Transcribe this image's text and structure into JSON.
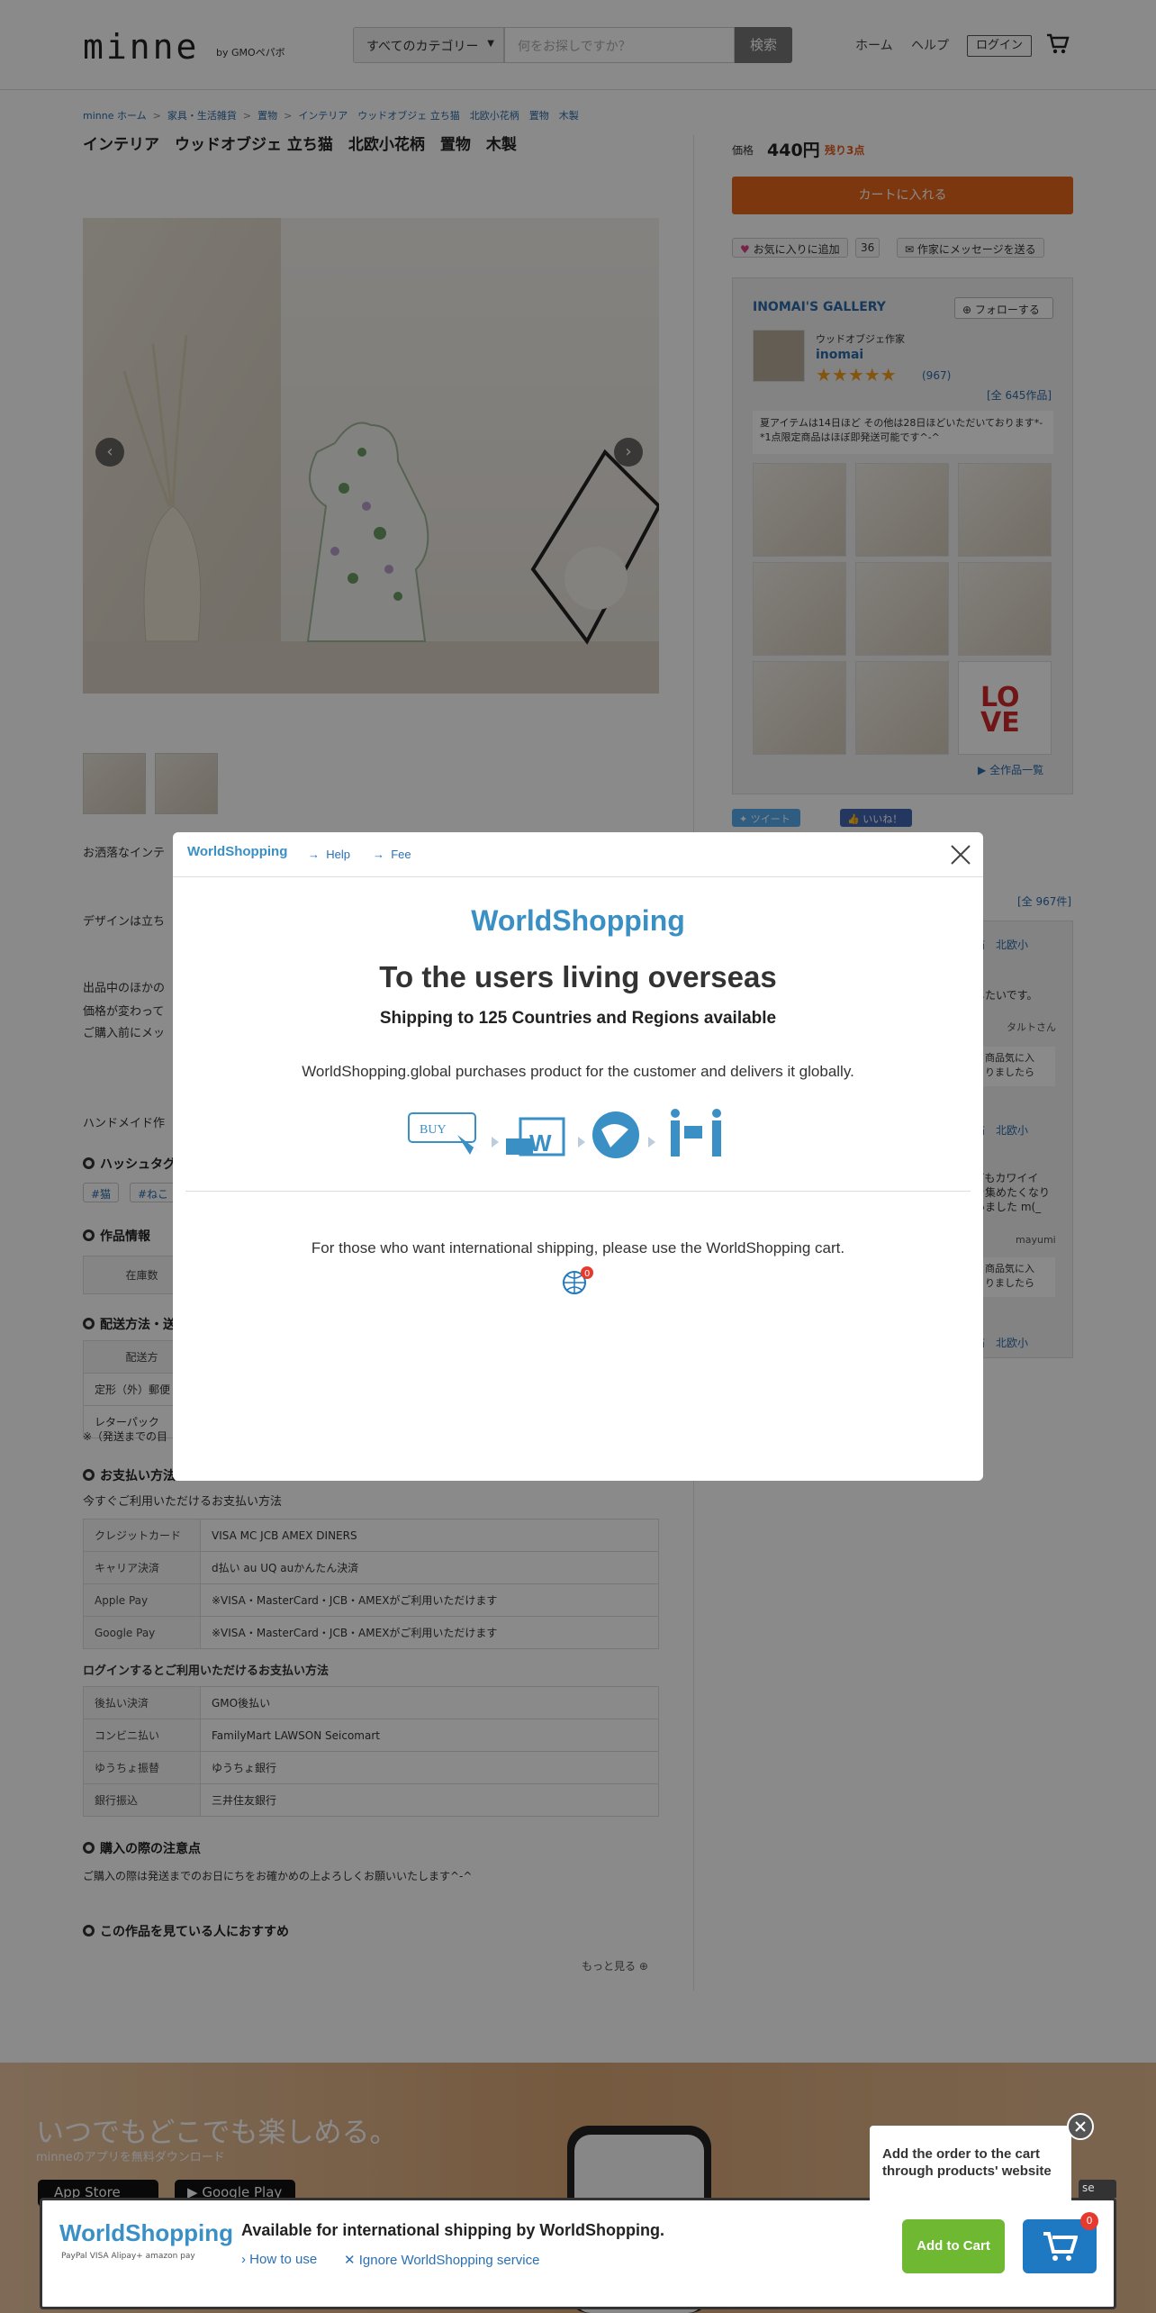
{
  "header": {
    "logo": "minne",
    "logo_sub": "by GMOペパボ",
    "category_select": "すべてのカテゴリー",
    "search_placeholder": "何をお探しですか？",
    "search_button": "検索",
    "nav": [
      "ホーム",
      "ヘルプ"
    ],
    "login": "ログイン"
  },
  "breadcrumb": [
    "minne ホーム",
    "家具・生活雑貨",
    "置物",
    "インテリア　ウッドオブジェ 立ち猫　北欧小花柄　置物　木製"
  ],
  "product": {
    "title": "インテリア　ウッドオブジェ 立ち猫　北欧小花柄　置物　木製",
    "description": [
      "お洒落なインテ",
      "デザインは立ち",
      "出品中のほかの",
      "価格が変わって",
      "ご購入前にメッ",
      "ハンドメイド作"
    ],
    "hashtag_heading": "ハッシュタグ",
    "tags": [
      "#猫",
      "#ねこ"
    ],
    "info_heading": "作品情報",
    "stock_label": "在庫数",
    "shipping_heading": "配送方法・送",
    "shipping_col": "配送方",
    "shipping_rows": [
      "定形（外）郵便",
      "レターパック"
    ],
    "shipping_note": "※（発送までの目",
    "payment_heading": "お支払い方法",
    "payment_now_label": "今すぐご利用いただけるお支払い方法",
    "payment_now": [
      {
        "label": "クレジットカード",
        "value": "VISA  MC  JCB  AMEX  DINERS"
      },
      {
        "label": "キャリア決済",
        "value": "d払い  au  UQ  auかんたん決済"
      },
      {
        "label": "Apple Pay",
        "value": "※VISA・MasterCard・JCB・AMEXがご利用いただけます"
      },
      {
        "label": "Google Pay",
        "value": "※VISA・MasterCard・JCB・AMEXがご利用いただけます"
      }
    ],
    "payment_login_label": "ログインするとご利用いただけるお支払い方法",
    "payment_login": [
      {
        "label": "後払い決済",
        "value": "GMO後払い"
      },
      {
        "label": "コンビニ払い",
        "value": "FamilyMart  LAWSON  Seicomart"
      },
      {
        "label": "ゆうちょ振替",
        "value": "ゆうちょ銀行"
      },
      {
        "label": "銀行振込",
        "value": "三井住友銀行"
      }
    ],
    "caution_heading": "購入の際の注意点",
    "caution_text": "ご購入の際は発送までのお日にちをお確かめの上よろしくお願いいたします^-^",
    "recommend_heading": "この作品を見ている人におすすめ",
    "more": "もっと見る"
  },
  "sidebar": {
    "price_label": "価格",
    "price": "440円",
    "remaining": "残り3点",
    "cart_button": "カートに入れる",
    "favorite": "お気に入りに追加",
    "favorite_count": "36",
    "message": "作家にメッセージを送る",
    "gallery_title": "INOMAI'S GALLERY",
    "follow": "フォローする",
    "artist_desc": "ウッドオブジェ作家",
    "artist_name": "inomai",
    "rating_count": "(967)",
    "works_count": "[全 645作品]",
    "notice": "夏アイテムは14日ほど その他は28日ほどいただいております*-*1点限定商品はほぼ即発送可能です^-^",
    "all_works": "全作品一覧",
    "tweet": "ツイート",
    "like": "いいね！",
    "reviews_count": "[全 967件]",
    "review_snippets": [
      "猫　北欧小",
      "したいです。",
      "タルトさん",
      "商品気に入",
      "りましたら",
      "猫　北欧小",
      "てもカワイイ",
      "を集めたくなり",
      "いました m(_",
      "mayumi",
      "商品気に入",
      "りましたら",
      "猫　北欧小"
    ]
  },
  "modal": {
    "logo": "WorldShopping",
    "help": "Help",
    "fee": "Fee",
    "heading": "To the users living overseas",
    "subheading": "Shipping to 125 Countries and Regions available",
    "paragraph": "WorldShopping.global purchases product for the customer and delivers it globally.",
    "buy_label": "BUY",
    "footer_text": "For those who want international shipping, please use the WorldShopping cart.",
    "cart_badge": "0"
  },
  "app_banner": {
    "title": "いつでもどこでも楽しめる。",
    "subtitle": "minneのアプリを無料ダウンロード",
    "app_store": "App Store",
    "google_play": "Google Play"
  },
  "ws_bar": {
    "logo": "WorldShopping",
    "payments": "PayPal  VISA  Alipay+  amazon pay",
    "title": "Available for international shipping by WorldShopping.",
    "how_to": "How to use",
    "ignore": "Ignore WorldShopping service",
    "add_to_cart": "Add to Cart",
    "cart_badge": "0",
    "tooltip": "Add the order to the cart through products' website",
    "close_edge": "se"
  },
  "colors": {
    "accent": "#e8661c",
    "link": "#2b6aa8",
    "ws_blue": "#3a8fc5",
    "ws_green": "#6eb832"
  }
}
